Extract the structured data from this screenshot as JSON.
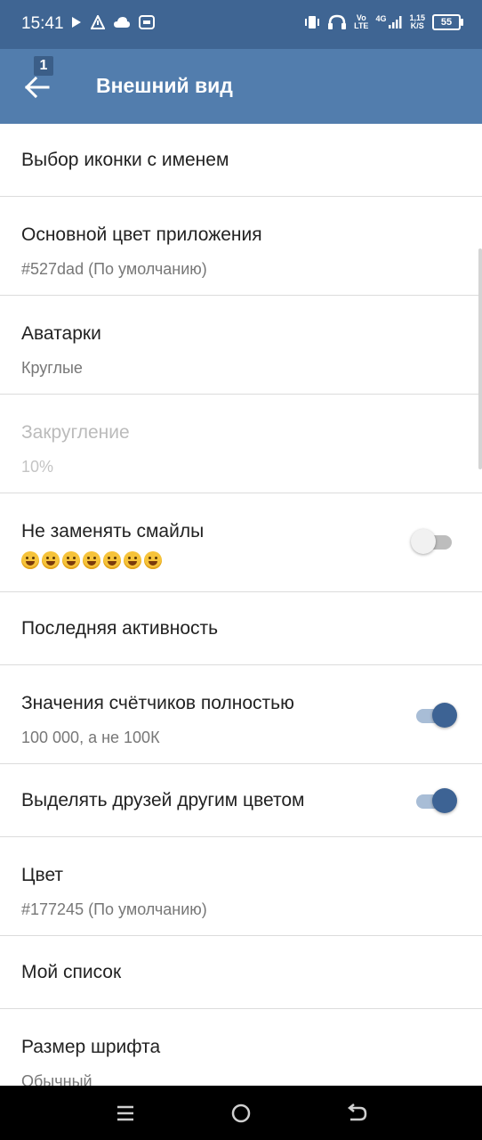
{
  "status_bar": {
    "time": "15:41",
    "volte_top": "Vo",
    "volte_bottom": "LTE",
    "network": "4G",
    "speed_value": "1,15",
    "speed_unit": "K/S",
    "battery": "55",
    "left_icons": [
      "play-icon",
      "signal-alert-icon",
      "cloud-icon",
      "media-icon"
    ],
    "right_icons": [
      "vibrate-icon",
      "headphones-icon",
      "volte-icon",
      "signal-4g-icon",
      "data-speed-icon",
      "battery-icon"
    ]
  },
  "app_bar": {
    "back_icon": "arrow-left-icon",
    "back_badge": "1",
    "title": "Внешний вид",
    "color": "#527dad"
  },
  "settings": {
    "icon_with_name": {
      "title": "Выбор иконки с именем"
    },
    "primary_color": {
      "title": "Основной цвет приложения",
      "subtitle": "#527dad (По умолчанию)"
    },
    "avatars": {
      "title": "Аватарки",
      "subtitle": "Круглые"
    },
    "rounding": {
      "title": "Закругление",
      "subtitle": "10%",
      "enabled": false
    },
    "keep_smileys": {
      "title": "Не заменять смайлы",
      "emoji_count": 7,
      "toggle": false
    },
    "last_activity": {
      "title": "Последняя активность"
    },
    "full_counters": {
      "title": "Значения счётчиков полностью",
      "subtitle": "100 000, а не 100К",
      "toggle": true
    },
    "highlight_friends": {
      "title": "Выделять друзей другим цветом",
      "toggle": true
    },
    "color": {
      "title": "Цвет",
      "subtitle": "#177245 (По умолчанию)"
    },
    "my_list": {
      "title": "Мой список"
    },
    "font_size": {
      "title": "Размер шрифта",
      "subtitle": "Обычный"
    }
  },
  "nav_bar": {
    "icons": [
      "menu-icon",
      "home-icon",
      "back-icon"
    ]
  },
  "colors": {
    "status_bar": "#3f6593",
    "toggle_on": "#3d6394",
    "toggle_off": "#bdbdbd"
  }
}
